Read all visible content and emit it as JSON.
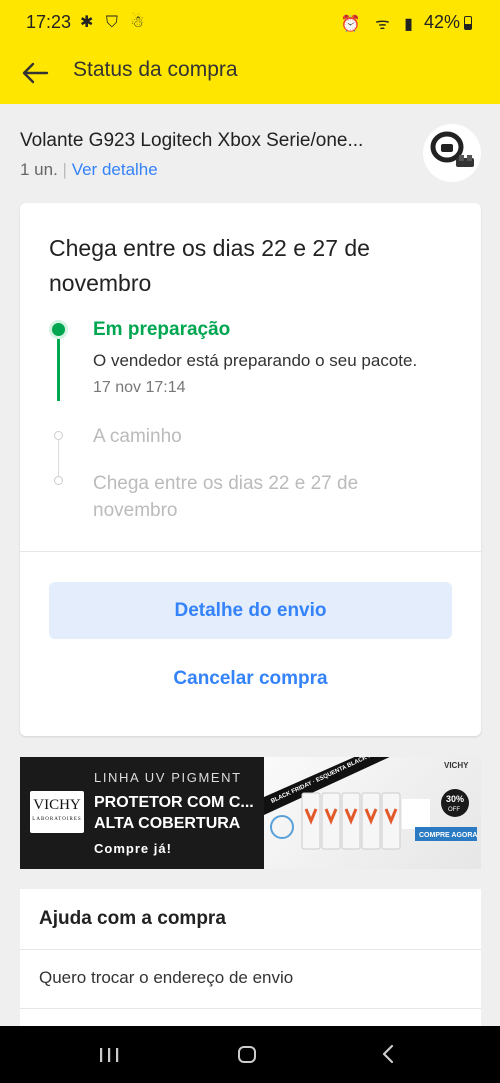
{
  "status_bar": {
    "time": "17:23",
    "left_icons": "✱ ⛉ ☃",
    "right_icons": "⏰ ᯤ ▮",
    "battery": "42%"
  },
  "header": {
    "title": "Status da compra",
    "back_icon": "arrow-left-icon",
    "bg_color": "#fee600"
  },
  "product": {
    "name": "Volante G923 Logitech Xbox Serie/one...",
    "quantity": "1 un.",
    "separator": "|",
    "detail_link": "Ver detalhe"
  },
  "delivery": {
    "headline": "Chega entre os dias 22 e 27 de novembro",
    "steps": [
      {
        "label": "Em preparação",
        "description": "O vendedor está preparando o seu pacote.",
        "time": "17 nov 17:14",
        "active": true
      },
      {
        "label": "A caminho",
        "active": false
      },
      {
        "label": "Chega entre os dias 22 e 27 de novembro",
        "active": false
      }
    ],
    "accent_color": "#00a650",
    "shipping_detail_button": "Detalhe do envio",
    "cancel_button": "Cancelar compra",
    "link_color": "#3483fa"
  },
  "ad_banner": {
    "brand": "VICHY",
    "brand_sub": "LABORATOIRES",
    "line": "LINHA UV PIGMENT",
    "headline_1": "PROTETOR COM C...",
    "headline_2": "ALTA COBERTURA",
    "cta": "Compre já!",
    "promo_ribbon": "BLACK FRIDAY · ESQUENTA BLACK FRIDAY",
    "discount": "30%",
    "discount_label": "OFF",
    "shop_button": "COMPRE AGORA",
    "product_label": "VICHY"
  },
  "help": {
    "title": "Ajuda com a compra",
    "items": [
      "Quero trocar o endereço de envio"
    ]
  },
  "nav_bar": {
    "recent_icon": "recent-apps-icon",
    "home_icon": "home-icon",
    "back_icon": "nav-back-icon"
  }
}
